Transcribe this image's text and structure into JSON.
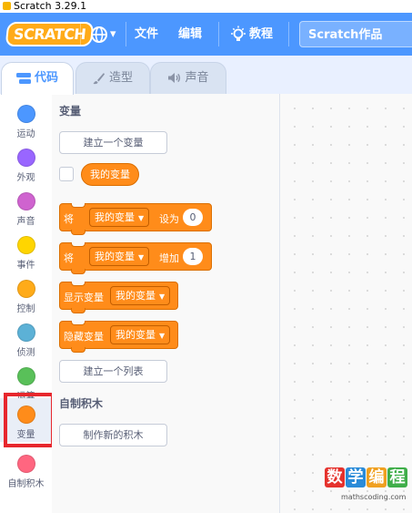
{
  "window": {
    "title": "Scratch 3.29.1"
  },
  "menubar": {
    "logo": "SCRATCH",
    "language_caret": "▾",
    "file": "文件",
    "edit": "编辑",
    "tutorials": "教程",
    "project_title": "Scratch作品"
  },
  "tabs": [
    {
      "label": "代码",
      "active": true
    },
    {
      "label": "造型",
      "active": false
    },
    {
      "label": "声音",
      "active": false
    }
  ],
  "categories": [
    {
      "label": "运动",
      "color": "#4c97ff"
    },
    {
      "label": "外观",
      "color": "#9966ff"
    },
    {
      "label": "声音",
      "color": "#cf63cf"
    },
    {
      "label": "事件",
      "color": "#ffd500"
    },
    {
      "label": "控制",
      "color": "#ffab19"
    },
    {
      "label": "侦测",
      "color": "#5cb1d6"
    },
    {
      "label": "运算",
      "color": "#59c059"
    },
    {
      "label": "变量",
      "color": "#ff8c1a"
    },
    {
      "label": "自制积木",
      "color": "#ff6680"
    }
  ],
  "palette": {
    "variables_title": "变量",
    "make_variable_button": "建立一个变量",
    "my_variable_reporter": "我的变量",
    "set_block": {
      "prefix": "将",
      "variable": "我的变量",
      "middle": "设为",
      "value": "0"
    },
    "change_block": {
      "prefix": "将",
      "variable": "我的变量",
      "middle": "增加",
      "value": "1"
    },
    "show_block": {
      "prefix": "显示变量",
      "variable": "我的变量"
    },
    "hide_block": {
      "prefix": "隐藏变量",
      "variable": "我的变量"
    },
    "make_list_button": "建立一个列表",
    "my_blocks_title": "自制积木",
    "make_block_button": "制作新的积木"
  },
  "watermark": {
    "glyphs": [
      "数",
      "学",
      "编",
      "程"
    ],
    "url": "mathscoding.com"
  },
  "colors": {
    "menubar": "#4c97ff",
    "variables": "#ff8c1a",
    "highlight": "#e7272d"
  }
}
